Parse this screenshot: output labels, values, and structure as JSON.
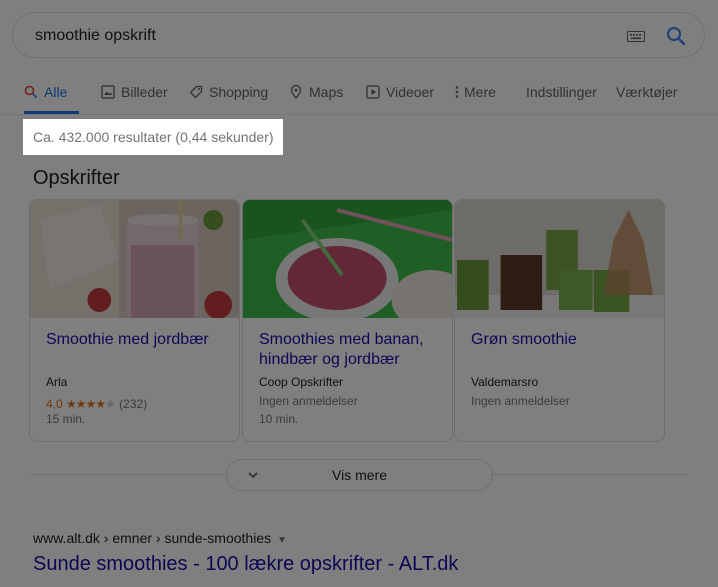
{
  "search": {
    "query": "smoothie opskrift"
  },
  "tabs": [
    {
      "label": "Alle",
      "icon": "search-icon"
    },
    {
      "label": "Billeder",
      "icon": "image-icon"
    },
    {
      "label": "Shopping",
      "icon": "tag-icon"
    },
    {
      "label": "Maps",
      "icon": "map-pin-icon"
    },
    {
      "label": "Videoer",
      "icon": "video-icon"
    },
    {
      "label": "Mere",
      "icon": "more-vert-icon"
    },
    {
      "label": "Indstillinger"
    },
    {
      "label": "Værktøjer"
    }
  ],
  "results_stats": "Ca. 432.000 resultater (0,44 sekunder)",
  "recipes": {
    "title": "Opskrifter",
    "cards": [
      {
        "title": "Smoothie med jordbær",
        "source": "Arla",
        "rating": "4,0",
        "stars": "★★★★",
        "stars_off": "★",
        "reviews": "(232)",
        "time": "15 min."
      },
      {
        "title": "Smoothies med banan, hindbær og jordbær",
        "source": "Coop Opskrifter",
        "reviews_text": "Ingen anmeldelser",
        "time": "10 min."
      },
      {
        "title": "Grøn smoothie",
        "source": "Valdemarsro",
        "reviews_text": "Ingen anmeldelser"
      }
    ],
    "more_label": "Vis mere"
  },
  "result": {
    "url": "www.alt.dk › emner › sunde-smoothies",
    "title": "Sunde smoothies - 100 lækre opskrifter - ALT.dk"
  },
  "colors": {
    "accent": "#1a73e8",
    "link": "#1a0dab",
    "star": "#e7711b"
  }
}
